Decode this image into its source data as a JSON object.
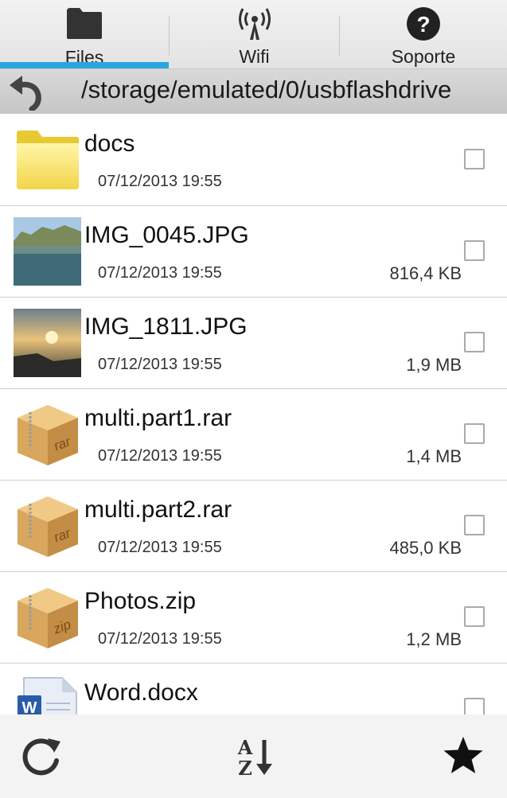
{
  "tabs": [
    {
      "label": "Files",
      "icon": "folder-icon",
      "active": true
    },
    {
      "label": "Wifi",
      "icon": "wifi-antenna-icon",
      "active": false
    },
    {
      "label": "Soporte",
      "icon": "help-icon",
      "active": false
    }
  ],
  "accent_color": "#2ba5df",
  "path": "/storage/emulated/0/usbflashdrive",
  "files": [
    {
      "name": "docs",
      "date": "07/12/2013 19:55",
      "size": "",
      "type": "folder",
      "icon": "folder-icon"
    },
    {
      "name": "IMG_0045.JPG",
      "date": "07/12/2013 19:55",
      "size": "816,4 KB",
      "type": "image",
      "icon": "image-thumbnail-lake"
    },
    {
      "name": "IMG_1811.JPG",
      "date": "07/12/2013 19:55",
      "size": "1,9 MB",
      "type": "image",
      "icon": "image-thumbnail-sunset"
    },
    {
      "name": "multi.part1.rar",
      "date": "07/12/2013 19:55",
      "size": "1,4 MB",
      "type": "archive",
      "icon": "rar-box-icon",
      "badge": "rar"
    },
    {
      "name": "multi.part2.rar",
      "date": "07/12/2013 19:55",
      "size": "485,0 KB",
      "type": "archive",
      "icon": "rar-box-icon",
      "badge": "rar"
    },
    {
      "name": "Photos.zip",
      "date": "07/12/2013 19:55",
      "size": "1,2 MB",
      "type": "archive",
      "icon": "zip-box-icon",
      "badge": "zip"
    },
    {
      "name": "Word.docx",
      "date": "",
      "size": "",
      "type": "document",
      "icon": "word-document-icon",
      "badge": "W"
    }
  ],
  "bottom_bar": [
    {
      "icon": "refresh-icon"
    },
    {
      "icon": "sort-az-icon",
      "text_top": "A",
      "text_bottom": "Z"
    },
    {
      "icon": "star-icon"
    }
  ]
}
